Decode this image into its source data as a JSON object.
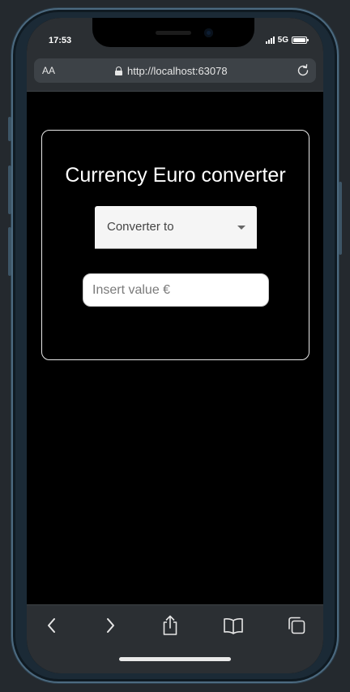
{
  "status_bar": {
    "time": "17:53",
    "network": "5G"
  },
  "browser": {
    "text_size_label": "AA",
    "url": "http://localhost:63078"
  },
  "converter": {
    "title": "Currency Euro converter",
    "select_label": "Converter to",
    "input_placeholder": "Insert value €",
    "input_value": ""
  },
  "toolbar": {
    "icons": [
      "back-icon",
      "forward-icon",
      "share-icon",
      "bookmarks-icon",
      "tabs-icon"
    ]
  },
  "colors": {
    "page_background": "#000000",
    "card_border": "#e8e8e8",
    "chrome": "#2b2f33"
  }
}
